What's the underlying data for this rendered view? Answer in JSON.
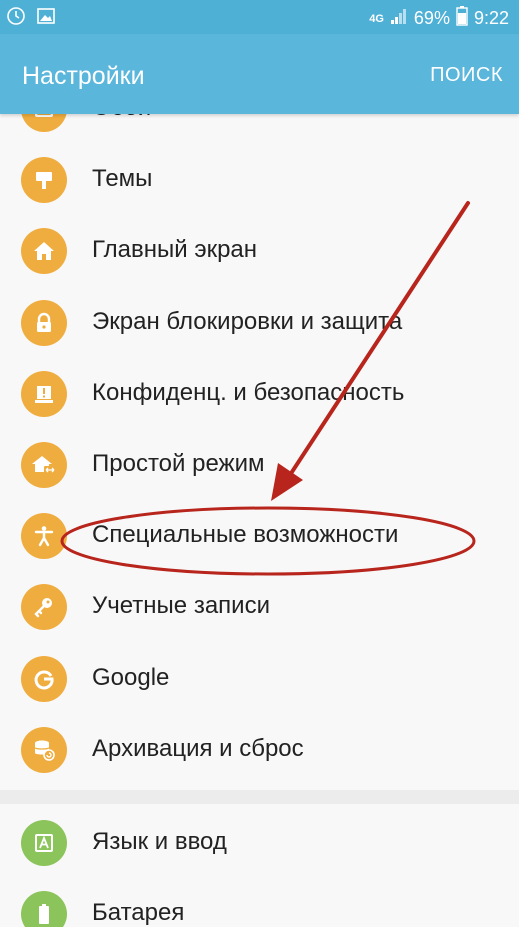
{
  "status_bar": {
    "network": "4G",
    "battery": "69%",
    "time": "9:22"
  },
  "app_bar": {
    "title": "Настройки",
    "search_label": "ПОИСК"
  },
  "settings_items": [
    {
      "label": "Обои",
      "icon": "wallpaper-icon"
    },
    {
      "label": "Темы",
      "icon": "theme-brush-icon"
    },
    {
      "label": "Главный экран",
      "icon": "home-icon"
    },
    {
      "label": "Экран блокировки и защита",
      "icon": "lock-icon"
    },
    {
      "label": "Конфиденц. и безопасность",
      "icon": "privacy-shield-icon"
    },
    {
      "label": "Простой режим",
      "icon": "easy-mode-icon"
    },
    {
      "label": "Специальные возможности",
      "icon": "accessibility-icon"
    },
    {
      "label": "Учетные записи",
      "icon": "key-icon"
    },
    {
      "label": "Google",
      "icon": "google-icon"
    },
    {
      "label": "Архивация и сброс",
      "icon": "backup-reset-icon"
    }
  ],
  "system_items": [
    {
      "label": "Язык и ввод",
      "icon": "language-icon"
    },
    {
      "label": "Батарея",
      "icon": "battery-icon"
    }
  ],
  "colors": {
    "app_bar": "#5bb6dc",
    "status_bar": "#4fb0d6",
    "icon_orange": "#f0ad3f",
    "icon_green": "#8bc45a",
    "annotation_red": "#b8251c"
  }
}
